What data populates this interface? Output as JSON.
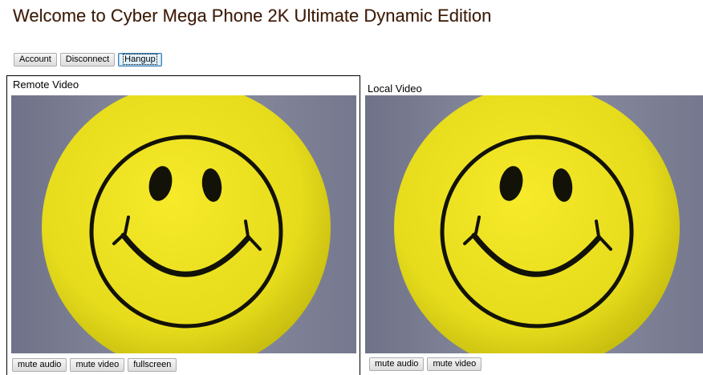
{
  "header": {
    "title": "Welcome to Cyber Mega Phone 2K Ultimate Dynamic Edition"
  },
  "toolbar": {
    "account_label": "Account",
    "disconnect_label": "Disconnect",
    "hangup_label": "Hangup"
  },
  "remote": {
    "label": "Remote Video",
    "mute_audio_label": "mute audio",
    "mute_video_label": "mute video",
    "fullscreen_label": "fullscreen"
  },
  "local": {
    "label": "Local Video",
    "mute_audio_label": "mute audio",
    "mute_video_label": "mute video"
  },
  "colors": {
    "smiley_yellow": "#ece11e",
    "video_background": "#7c7f92",
    "title_color": "#3a1a08"
  }
}
